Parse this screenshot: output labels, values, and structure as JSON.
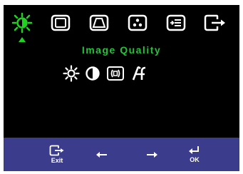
{
  "osd": {
    "title": "Image Quality",
    "colors": {
      "background": "#000000",
      "selected": "#1fd21f",
      "title": "#23c23a",
      "bar": "#3b3c8c",
      "icon": "#ffffff"
    },
    "tabs": [
      {
        "icon": "brightness-icon",
        "selected": true
      },
      {
        "icon": "screen-position-icon",
        "selected": false
      },
      {
        "icon": "image-setup-icon",
        "selected": false
      },
      {
        "icon": "color-icon",
        "selected": false
      },
      {
        "icon": "options-icon",
        "selected": false
      },
      {
        "icon": "exit-icon",
        "selected": false
      }
    ],
    "sub_icons": [
      "brightness-icon",
      "contrast-icon",
      "screen-size-icon",
      "sharpness-icon"
    ],
    "buttons": {
      "exit": "Exit",
      "left": "",
      "right": "",
      "ok": "OK"
    }
  }
}
